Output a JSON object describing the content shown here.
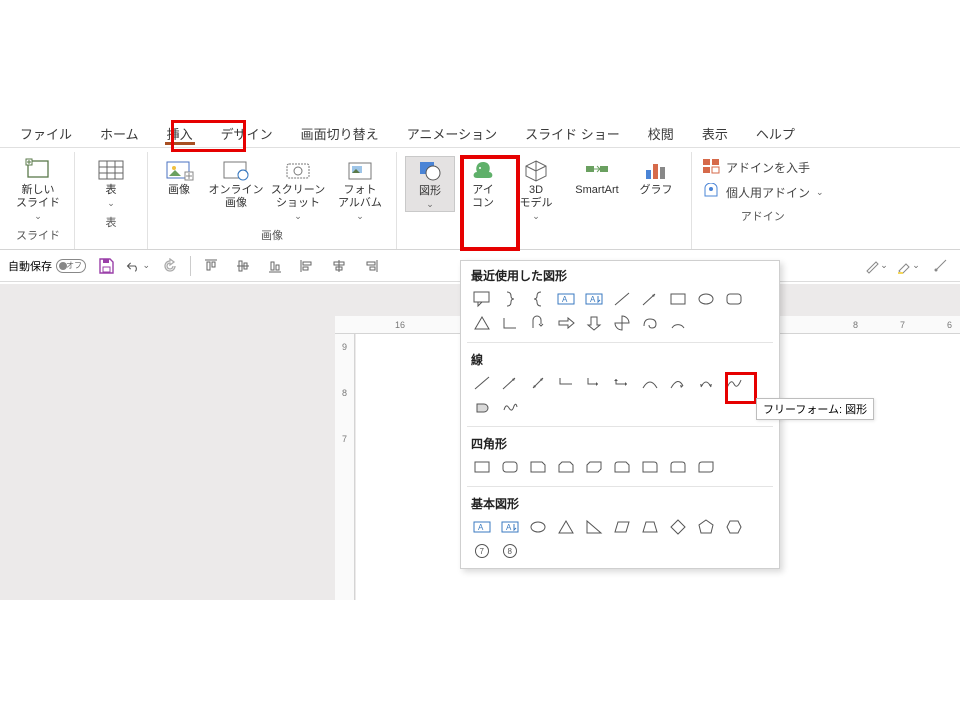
{
  "tabs": {
    "file": "ファイル",
    "home": "ホーム",
    "insert": "挿入",
    "design": "デザイン",
    "transition": "画面切り替え",
    "animation": "アニメーション",
    "slideshow": "スライド ショー",
    "review": "校閲",
    "view": "表示",
    "help": "ヘルプ"
  },
  "ribbon": {
    "slides": {
      "newSlide": "新しい\nスライド",
      "label": "スライド"
    },
    "tables": {
      "table": "表",
      "label": "表"
    },
    "images": {
      "picture": "画像",
      "online": "オンライン\n画像",
      "screenshot": "スクリーン\nショット",
      "album": "フォト\nアルバム",
      "label": "画像"
    },
    "illust": {
      "shapes": "図形",
      "icons": "アイ\nコン",
      "model3d": "3D\nモデル",
      "smartart": "SmartArt",
      "chart": "グラフ"
    },
    "addins": {
      "get": "アドインを入手",
      "my": "個人用アドイン",
      "label": "アドイン"
    }
  },
  "qat": {
    "autosave": "自動保存",
    "off": "オフ"
  },
  "popup": {
    "recent": "最近使用した図形",
    "lines": "線",
    "rects": "四角形",
    "basic": "基本図形"
  },
  "tooltip": "フリーフォーム: 図形",
  "ruler_h_left": "16",
  "ruler_h_right": [
    "8",
    "7",
    "6"
  ],
  "ruler_v": [
    "9",
    "8",
    "7"
  ]
}
